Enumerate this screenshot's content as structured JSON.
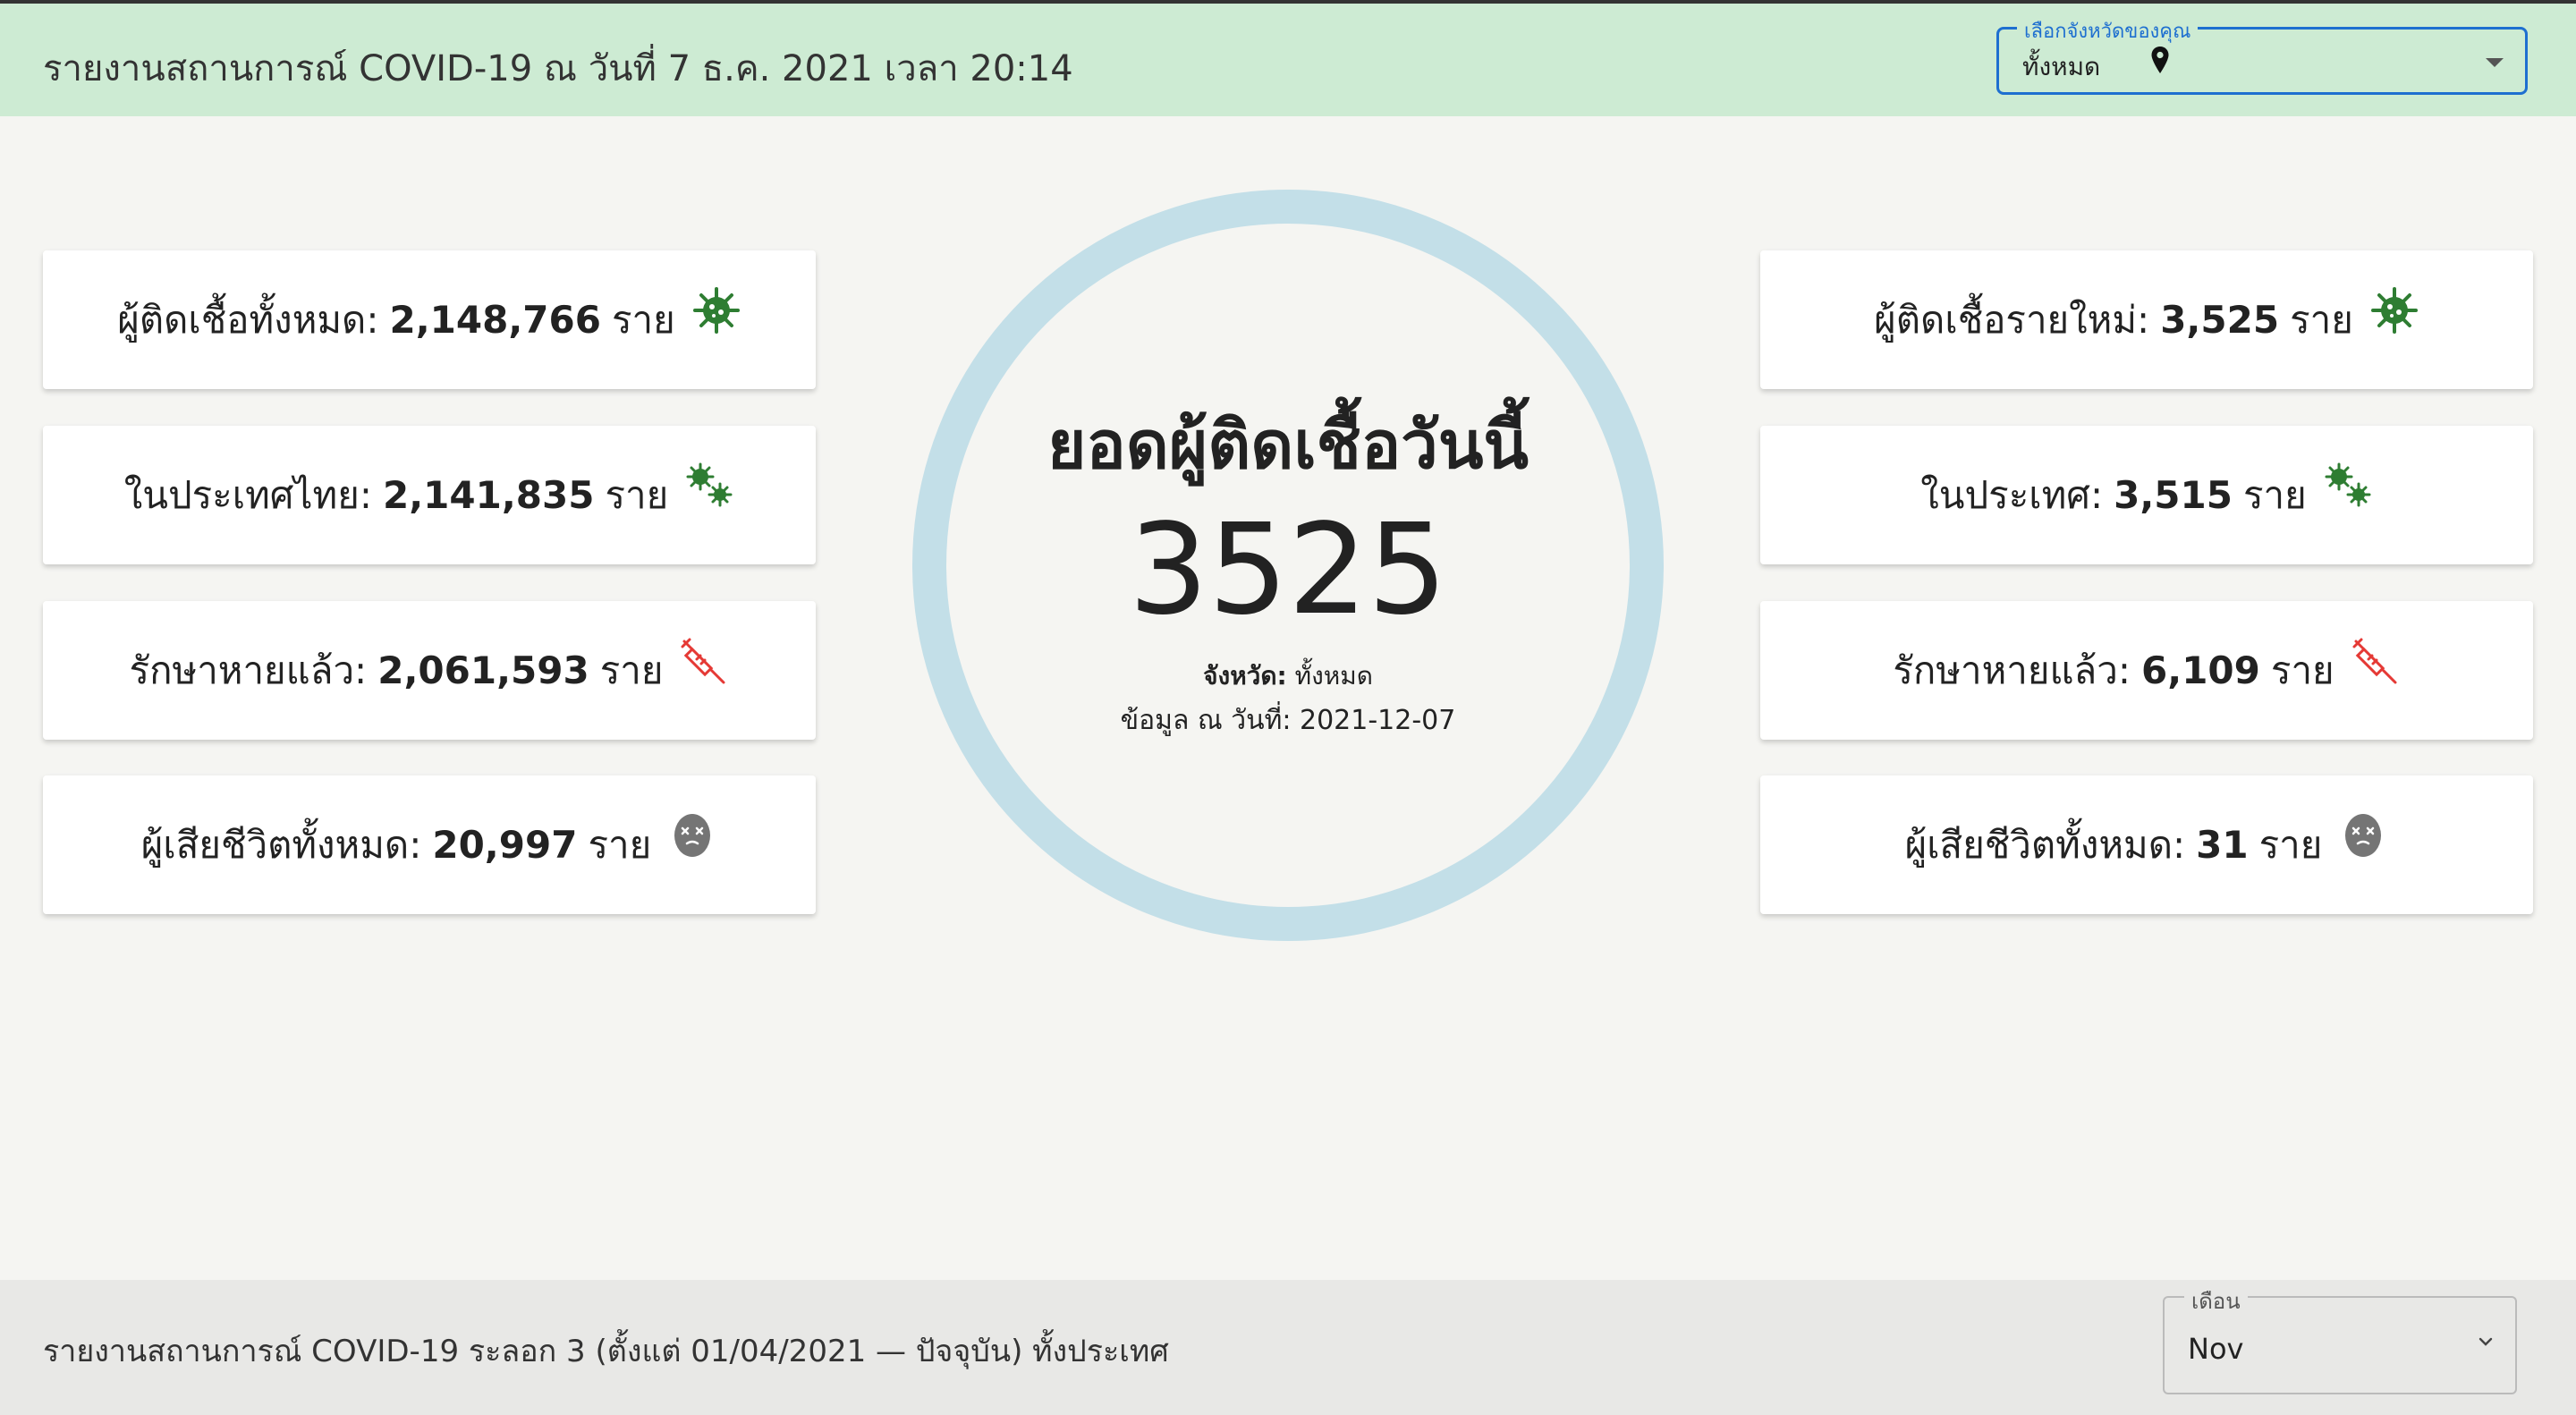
{
  "header": {
    "title": "รายงานสถานการณ์ COVID-19 ณ วันที่ 7 ธ.ค. 2021 เวลา 20:14",
    "province_select": {
      "label": "เลือกจังหวัดของคุณ",
      "value": "ทั้งหมด"
    }
  },
  "left_cards": [
    {
      "label": "ผู้ติดเชื้อทั้งหมด:",
      "value": "2,148,766",
      "unit": "ราย",
      "icon": "virus-icon"
    },
    {
      "label": "ในประเทศไทย:",
      "value": "2,141,835",
      "unit": "ราย",
      "icon": "viruses-icon"
    },
    {
      "label": "รักษาหายแล้ว:",
      "value": "2,061,593",
      "unit": "ราย",
      "icon": "syringe-icon"
    },
    {
      "label": "ผู้เสียชีวิตทั้งหมด:",
      "value": "20,997",
      "unit": "ราย",
      "icon": "dead-face-icon"
    }
  ],
  "right_cards": [
    {
      "label": "ผู้ติดเชื้อรายใหม่:",
      "value": "3,525",
      "unit": "ราย",
      "icon": "virus-icon"
    },
    {
      "label": "ในประเทศ:",
      "value": "3,515",
      "unit": "ราย",
      "icon": "viruses-icon"
    },
    {
      "label": "รักษาหายแล้ว:",
      "value": "6,109",
      "unit": "ราย",
      "icon": "syringe-icon"
    },
    {
      "label": "ผู้เสียชีวิตทั้งหมด:",
      "value": "31",
      "unit": "ราย",
      "icon": "dead-face-icon"
    }
  ],
  "center": {
    "title": "ยอดผู้ติดเชื้อวันนี้",
    "number": "3525",
    "province_label": "จังหวัด:",
    "province_value": "ทั้งหมด",
    "date_text": "ข้อมูล ณ วันที่: 2021-12-07"
  },
  "footer": {
    "title": "รายงานสถานการณ์ COVID-19 ระลอก 3 (ตั้งแต่ 01/04/2021 — ปัจจุบัน) ทั้งประเทศ",
    "month_select": {
      "label": "เดือน",
      "value": "Nov"
    }
  },
  "colors": {
    "header_bg": "#cdebd3",
    "accent_blue": "#1e6fd0",
    "ring": "#c3dfe8",
    "virus_green": "#2e7d32",
    "syringe_red": "#e53935",
    "dead_grey": "#757575"
  }
}
